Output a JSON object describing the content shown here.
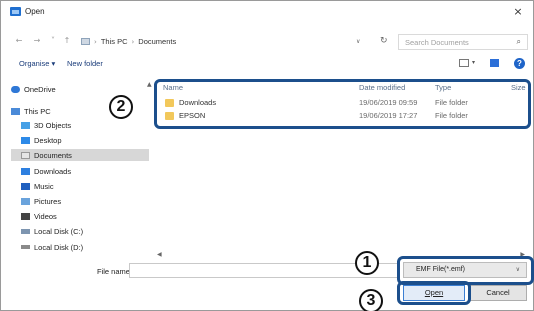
{
  "window": {
    "title": "Open",
    "close": "×"
  },
  "nav": {
    "back": "←",
    "forward": "→",
    "up_menu": "˅",
    "up": "↑",
    "breadcrumbs": [
      "This PC",
      "Documents"
    ],
    "separator": "›",
    "dropdown": "∨",
    "refresh": "↻",
    "search_placeholder": "Search Documents",
    "search_glyph": "⌕"
  },
  "toolbar": {
    "organise": "Organise ▾",
    "new_folder": "New folder",
    "view_drop": "▾",
    "help": "?"
  },
  "sidebar": {
    "items": [
      {
        "label": "OneDrive",
        "icon": "cloud-icon",
        "color": "#2f78d6",
        "selected": false
      },
      {
        "label": "This PC",
        "icon": "computer-icon",
        "color": "#4a8ad8",
        "selected": false
      },
      {
        "label": "3D Objects",
        "icon": "cube-icon",
        "color": "#46a0e6",
        "selected": false
      },
      {
        "label": "Desktop",
        "icon": "desktop-icon",
        "color": "#2d8ae8",
        "selected": false
      },
      {
        "label": "Documents",
        "icon": "document-icon",
        "color": "#e6e6e6",
        "selected": true
      },
      {
        "label": "Downloads",
        "icon": "download-icon",
        "color": "#2d7fe0",
        "selected": false
      },
      {
        "label": "Music",
        "icon": "music-icon",
        "color": "#1f5fbf",
        "selected": false
      },
      {
        "label": "Pictures",
        "icon": "pictures-icon",
        "color": "#6aa3dc",
        "selected": false
      },
      {
        "label": "Videos",
        "icon": "videos-icon",
        "color": "#444444",
        "selected": false
      },
      {
        "label": "Local Disk (C:)",
        "icon": "drive-icon",
        "color": "#7d95b0",
        "selected": false
      },
      {
        "label": "Local Disk (D:)",
        "icon": "drive-icon",
        "color": "#8a8a8a",
        "selected": false
      }
    ]
  },
  "files": {
    "columns": [
      "Name",
      "Date modified",
      "Type",
      "Size"
    ],
    "rows": [
      {
        "name": "Downloads",
        "date": "19/06/2019 09:59",
        "type": "File folder",
        "size": ""
      },
      {
        "name": "EPSON",
        "date": "19/06/2019 17:27",
        "type": "File folder",
        "size": ""
      }
    ]
  },
  "bottom": {
    "filename_label": "File name:",
    "filename_value": "",
    "filter": "EMF File(*.emf)",
    "filter_drop": "∨",
    "open": "Open",
    "cancel": "Cancel"
  },
  "scroll": {
    "left": "◀",
    "right": "▶",
    "up": "▲"
  },
  "callouts": [
    "①",
    "②",
    "③"
  ],
  "colors": {
    "callout": "#1c4f8c",
    "folder": "#f2c85b",
    "selected": "#d7d7d7"
  }
}
